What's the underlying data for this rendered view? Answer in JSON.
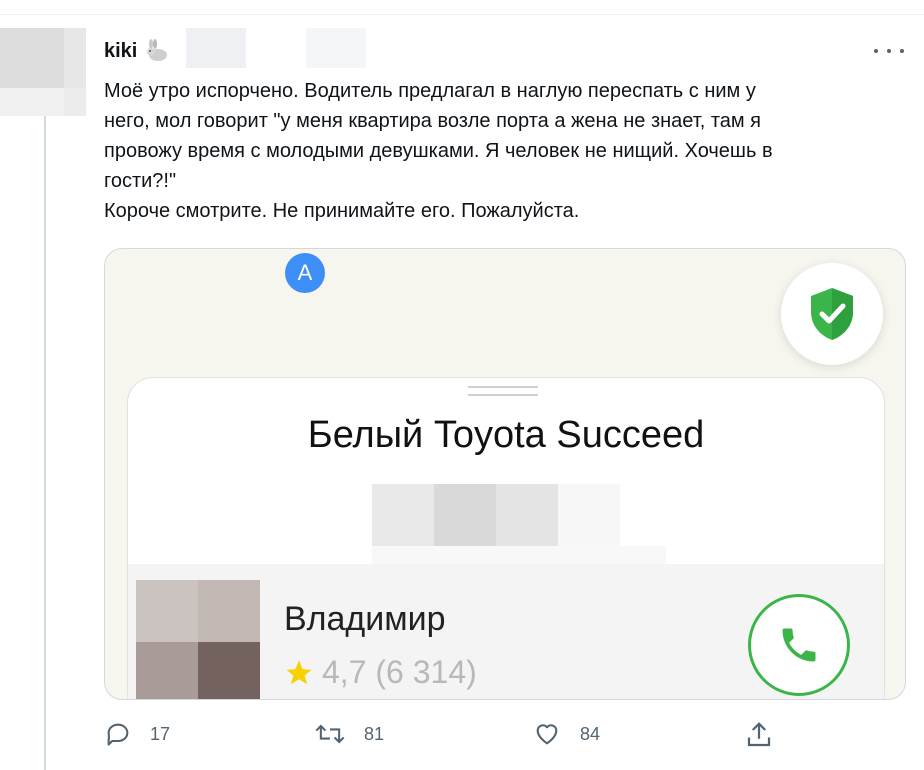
{
  "tweet": {
    "username": "kiki",
    "text": "Моё утро испорчено. Водитель предлагал в наглую переспать с ним у\nнего, мол говорит \"у меня квартира возле порта а жена не знает, там я\nпровожу время с молодыми девушками. Я человек не нищий. Хочешь в\nгости?!\"\nКороче смотрите. Не принимайте его. Пожалуйста.",
    "more_icon": "more-horizontal-icon"
  },
  "screenshot": {
    "map_badge": "A",
    "car": "Белый Toyota Succeed",
    "driver_name": "Владимир",
    "rating": "4,7 (6 314)",
    "colors": {
      "shield": "#3bb54a",
      "phone": "#3bb54a",
      "badge": "#3d8ef7",
      "star": "#f7d000"
    }
  },
  "actions": {
    "reply_count": "17",
    "retweet_count": "81",
    "like_count": "84",
    "icons": [
      "reply-icon",
      "retweet-icon",
      "like-icon",
      "share-icon"
    ]
  },
  "colors": {
    "text": "#0f1419",
    "muted": "#536471",
    "border": "#cfd9de"
  }
}
